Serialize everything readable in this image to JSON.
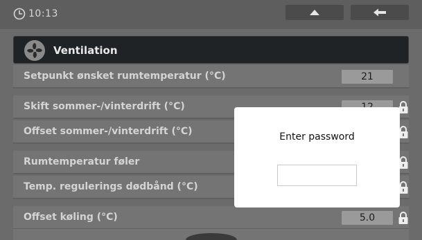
{
  "status_bar": {
    "time": "10:13",
    "icons": {
      "clock": "clock-icon",
      "home": "home-icon",
      "back": "back-arrow-icon"
    }
  },
  "header": {
    "title": "Ventilation",
    "icon": "fan-icon"
  },
  "rows": [
    {
      "label": "Setpunkt ønsket rumtemperatur (°C)",
      "value": "21",
      "locked": false
    },
    {
      "label": "Skift sommer-/vinterdrift (°C)",
      "value": "12",
      "locked": true
    },
    {
      "label": "Offset sommer-/vinterdrift (°C)",
      "value": "",
      "locked": true
    },
    {
      "label": "Rumtemperatur føler",
      "value": "",
      "locked": true
    },
    {
      "label": "Temp. regulerings dødbånd (°C)",
      "value": "",
      "locked": true
    },
    {
      "label": "Offset køling (°C)",
      "value": "5.0",
      "locked": true
    }
  ],
  "modal": {
    "title": "Enter password",
    "input_value": "",
    "input_placeholder": ""
  },
  "colors": {
    "background": "#6b6b6b",
    "header_bg": "#1f2326",
    "row_bg": "#747474",
    "value_bg": "#9a9a9a",
    "lock_color": "#e8e8e8",
    "modal_bg": "#ffffff"
  }
}
